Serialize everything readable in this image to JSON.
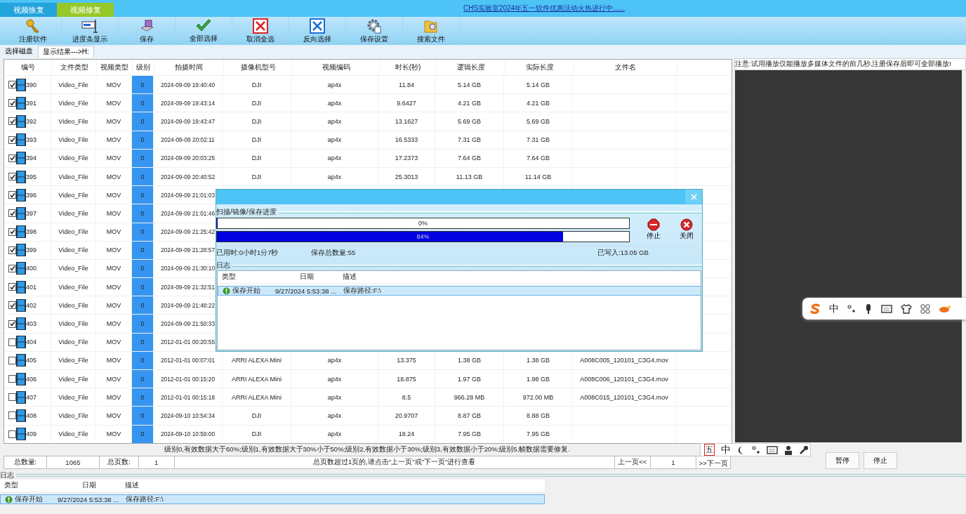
{
  "top_tabs": [
    {
      "label": "视频恢复",
      "selected": false
    },
    {
      "label": "视频修复",
      "selected": true
    }
  ],
  "promo_link": "CHS实验室2024年五一软件优惠活动火热进行中......",
  "toolbar": [
    {
      "label": "注册软件",
      "kind": "key"
    },
    {
      "label": "进度条显示",
      "kind": "monitor"
    },
    {
      "label": "保存",
      "kind": "save"
    },
    {
      "label": "全部选择",
      "kind": "check"
    },
    {
      "label": "取消全选",
      "kind": "cancel"
    },
    {
      "label": "反向选择",
      "kind": "invert"
    },
    {
      "label": "保存设置",
      "kind": "settings"
    },
    {
      "label": "搜索文件",
      "kind": "search"
    }
  ],
  "view_tabs": [
    {
      "label": "选择磁盘",
      "selected": false
    },
    {
      "label": "显示结果--->H:",
      "selected": true
    }
  ],
  "table": {
    "columns": [
      "编号",
      "文件类型",
      "视频类型",
      "级别",
      "拍摄时间",
      "摄像机型号",
      "视频编码",
      "时长(秒)",
      "逻辑长度",
      "实际长度",
      "文件名"
    ],
    "rows": [
      {
        "checked": true,
        "cells": [
          "390",
          "Video_File",
          "MOV",
          "0",
          "2024-09-09 19:40:40",
          "DJI",
          "ap4x",
          "11.84",
          "5.14 GB",
          "5.14 GB"
        ]
      },
      {
        "checked": true,
        "cells": [
          "391",
          "Video_File",
          "MOV",
          "0",
          "2024-09-09 19:43:14",
          "DJI",
          "ap4x",
          "9.6427",
          "4.21 GB",
          "4.21 GB"
        ]
      },
      {
        "checked": true,
        "cells": [
          "392",
          "Video_File",
          "MOV",
          "0",
          "2024-09-09 19:43:47",
          "DJI",
          "ap4x",
          "13.1627",
          "5.69 GB",
          "5.69 GB"
        ]
      },
      {
        "checked": true,
        "cells": [
          "393",
          "Video_File",
          "MOV",
          "0",
          "2024-09-09 20:02:11",
          "DJI",
          "ap4x",
          "16.5333",
          "7.31 GB",
          "7.31 GB"
        ]
      },
      {
        "checked": true,
        "cells": [
          "394",
          "Video_File",
          "MOV",
          "0",
          "2024-09-09 20:03:25",
          "DJI",
          "ap4x",
          "17.2373",
          "7.64 GB",
          "7.64 GB"
        ]
      },
      {
        "checked": true,
        "cells": [
          "395",
          "Video_File",
          "MOV",
          "0",
          "2024-09-09 20:40:52",
          "DJI",
          "ap4x",
          "25.3013",
          "11.13 GB",
          "11.14 GB"
        ]
      },
      {
        "checked": true,
        "cells": [
          "396",
          "Video_File",
          "MOV",
          "0",
          "2024-09-09 21:01:03"
        ]
      },
      {
        "checked": true,
        "cells": [
          "397",
          "Video_File",
          "MOV",
          "0",
          "2024-09-09 21:01:46"
        ]
      },
      {
        "checked": true,
        "cells": [
          "398",
          "Video_File",
          "MOV",
          "0",
          "2024-09-09 21:25:42"
        ]
      },
      {
        "checked": true,
        "cells": [
          "399",
          "Video_File",
          "MOV",
          "0",
          "2024-09-09 21:28:57"
        ]
      },
      {
        "checked": true,
        "cells": [
          "400",
          "Video_File",
          "MOV",
          "0",
          "2024-09-09 21:30:10"
        ]
      },
      {
        "checked": true,
        "cells": [
          "401",
          "Video_File",
          "MOV",
          "0",
          "2024-09-09 21:32:51"
        ]
      },
      {
        "checked": true,
        "cells": [
          "402",
          "Video_File",
          "MOV",
          "0",
          "2024-09-09 21:48:22"
        ]
      },
      {
        "checked": true,
        "cells": [
          "403",
          "Video_File",
          "MOV",
          "0",
          "2024-09-09 21:50:33"
        ]
      },
      {
        "checked": false,
        "cells": [
          "404",
          "Video_File",
          "MOV",
          "0",
          "2012-01-01 00:20:55"
        ]
      },
      {
        "checked": false,
        "cells": [
          "405",
          "Video_File",
          "MOV",
          "0",
          "2012-01-01 00:07:01",
          "ARRI ALEXA Mini",
          "ap4x",
          "13.375",
          "1.38 GB",
          "1.38 GB",
          "A008C005_120101_C3G4.mov"
        ]
      },
      {
        "checked": false,
        "cells": [
          "406",
          "Video_File",
          "MOV",
          "0",
          "2012-01-01 00:15:20",
          "ARRI ALEXA Mini",
          "ap4x",
          "18.875",
          "1.97 GB",
          "1.98 GB",
          "A008C006_120101_C3G4.mov"
        ]
      },
      {
        "checked": false,
        "cells": [
          "407",
          "Video_File",
          "MOV",
          "0",
          "2012-01-01 00:15:18",
          "ARRI ALEXA Mini",
          "ap4x",
          "8.5",
          "966.28 MB",
          "972.00 MB",
          "A008C015_120101_C3G4.mov"
        ]
      },
      {
        "checked": false,
        "cells": [
          "408",
          "Video_File",
          "MOV",
          "0",
          "2024-09-10 10:54:34",
          "DJI",
          "ap4x",
          "20.9707",
          "8.87 GB",
          "8.88 GB"
        ]
      },
      {
        "checked": false,
        "cells": [
          "409",
          "Video_File",
          "MOV",
          "0",
          "2024-09-10 10:59:00",
          "DJI",
          "ap4x",
          "18.24",
          "7.95 GB",
          "7.95 GB"
        ]
      }
    ]
  },
  "legend": "级别0,有效数据大于60%;级别1,有效数据大于30%小于50%;级别2,有效数据小于30%;级别3,有效数据小于20%;级别5,帧数据需要修复.",
  "footer": {
    "total_label": "总数量:",
    "total": "1065",
    "pages_label": "总页数:",
    "pages": "1",
    "hint": "总页数超过1页的,请点击\"上一页\"或\"下一页\"进行查看",
    "prev": "上一页<<",
    "page": "1",
    "next": ">>下一页"
  },
  "player": {
    "notice": "注意:试用播放仅能播放多媒体文件的前几秒,注册保存后即可全部播放!",
    "buttons": [
      "暂停",
      "停止"
    ]
  },
  "log": {
    "title": "日志",
    "columns": [
      "类型",
      "日期",
      "描述"
    ],
    "rows": [
      {
        "type": "保存开始",
        "date": "9/27/2024 5:53:38 ...",
        "description": "保存路径:F:\\",
        "selected": true
      }
    ]
  },
  "dialog": {
    "section_title": "扫描/镜像/保存进度",
    "progress": [
      {
        "label": "0%",
        "level": 0
      },
      {
        "label": "84%",
        "level": 0.84
      }
    ],
    "buttons": [
      {
        "label": "停止",
        "kind": "stop"
      },
      {
        "label": "关闭",
        "kind": "close"
      }
    ],
    "elapsed": "已用时:0小时1分7秒",
    "saved_count": "保存总数量:55",
    "written": "已写入:13.05 GB",
    "log_title": "日志",
    "log_columns": [
      "类型",
      "日期",
      "描述"
    ],
    "log_rows": [
      {
        "type": "保存开始",
        "date": "9/27/2024 5:53:38 ...",
        "description": "保存路径:F:\\",
        "selected": true
      }
    ]
  },
  "ime_bars": [
    {
      "kind": "floating",
      "items": [
        {
          "kind": "logo"
        },
        {
          "kind": "text",
          "text": "中"
        },
        {
          "kind": "punct"
        },
        {
          "kind": "mic"
        },
        {
          "kind": "keyboard"
        },
        {
          "kind": "shirt"
        },
        {
          "kind": "grid"
        },
        {
          "kind": "badge"
        }
      ]
    },
    {
      "kind": "docked",
      "items": [
        {
          "kind": "boxed",
          "text": "五"
        },
        {
          "kind": "text",
          "text": "中"
        },
        {
          "kind": "moon"
        },
        {
          "kind": "punct"
        },
        {
          "kind": "keyboard"
        },
        {
          "kind": "person"
        },
        {
          "kind": "wrench"
        }
      ]
    }
  ]
}
